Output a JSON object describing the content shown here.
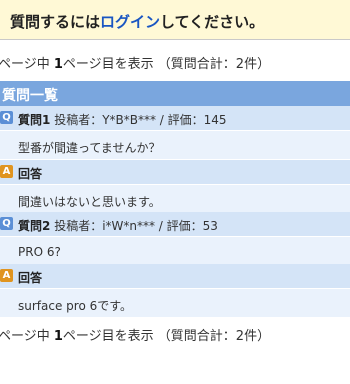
{
  "login_banner": {
    "login_link": "ログイン",
    "suffix": "してください。",
    "prefix": "質問するには"
  },
  "pager": {
    "text_a": "ページ中 ",
    "page_no": "1",
    "text_b": "ページ目を表示 （質問合計：2件）"
  },
  "section_title": "質問一覧",
  "questions": [
    {
      "label": "質問1",
      "poster": "投稿者：Y*B*B*** / 評価：145",
      "body": "型番が間違ってませんか？",
      "answer_label": "回答",
      "answer": "間違いはないと思います。"
    },
    {
      "label": "質問2",
      "poster": "投稿者：i*W*n*** / 評価：53",
      "body": "PRO 6?",
      "answer_label": "回答",
      "answer": "surface pro 6です。"
    }
  ],
  "badges": {
    "question": "Q",
    "answer": "A"
  },
  "colors": {
    "header_bg": "#7aa6de",
    "row_head_bg": "#d4e4f7",
    "row_body_bg": "#eaf2fc",
    "answer_badge": "#e0941f",
    "question_badge": "#5b8fd6",
    "login_link": "#1a56c2"
  }
}
